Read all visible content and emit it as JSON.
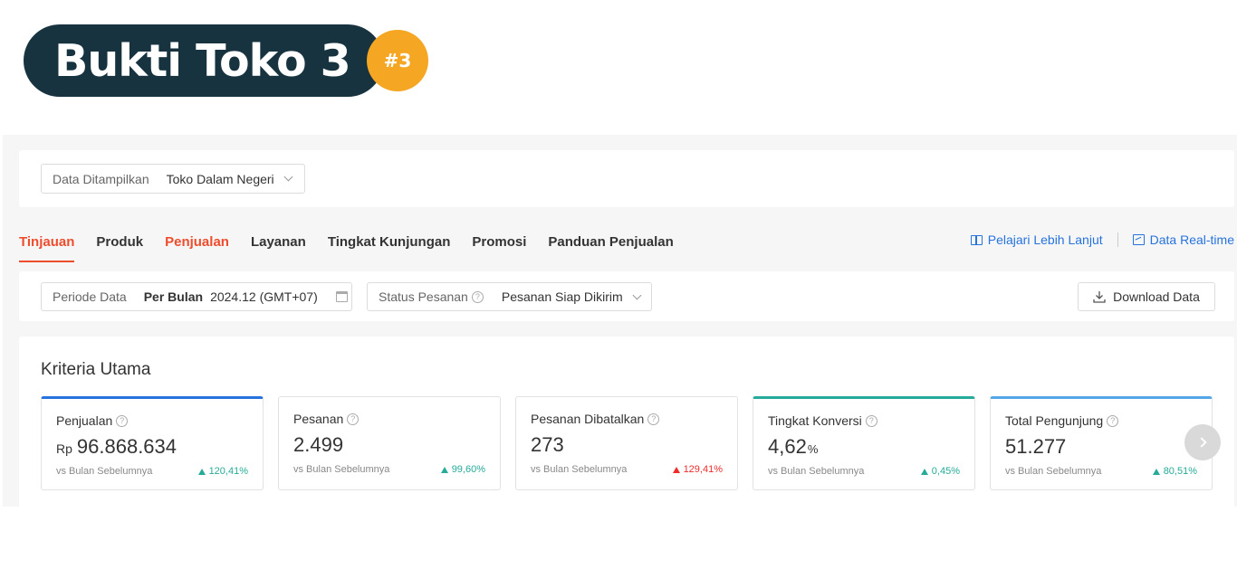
{
  "banner": {
    "title": "Bukti Toko 3",
    "badge": "#3"
  },
  "data_filter": {
    "label": "Data Ditampilkan",
    "value": "Toko Dalam Negeri"
  },
  "tabs": [
    {
      "label": "Tinjauan"
    },
    {
      "label": "Produk"
    },
    {
      "label": "Penjualan"
    },
    {
      "label": "Layanan"
    },
    {
      "label": "Tingkat Kunjungan"
    },
    {
      "label": "Promosi"
    },
    {
      "label": "Panduan Penjualan"
    }
  ],
  "links": {
    "learn_more": "Pelajari Lebih Lanjut",
    "realtime": "Data Real-time"
  },
  "period": {
    "label": "Periode Data",
    "unit": "Per Bulan",
    "value": "2024.12 (GMT+07)"
  },
  "order_status": {
    "label": "Status Pesanan",
    "value": "Pesanan Siap Dikirim"
  },
  "download_label": "Download Data",
  "criteria": {
    "title": "Kriteria Utama",
    "compare_label": "vs Bulan Sebelumnya",
    "metrics": [
      {
        "label": "Penjualan",
        "prefix": "Rp",
        "value": "96.868.634",
        "suffix": "",
        "delta": "120,41%"
      },
      {
        "label": "Pesanan",
        "prefix": "",
        "value": "2.499",
        "suffix": "",
        "delta": "99,60%"
      },
      {
        "label": "Pesanan Dibatalkan",
        "prefix": "",
        "value": "273",
        "suffix": "",
        "delta": "129,41%"
      },
      {
        "label": "Tingkat Konversi",
        "prefix": "",
        "value": "4,62",
        "suffix": "%",
        "delta": "0,45%"
      },
      {
        "label": "Total Pengunjung",
        "prefix": "",
        "value": "51.277",
        "suffix": "",
        "delta": "80,51%"
      }
    ]
  },
  "colors": {
    "accent": "#ee4d2d",
    "link": "#2673dd",
    "up": "#26aa99",
    "down": "#ee2c2c",
    "banner": "#173340",
    "badge": "#f5a623"
  }
}
